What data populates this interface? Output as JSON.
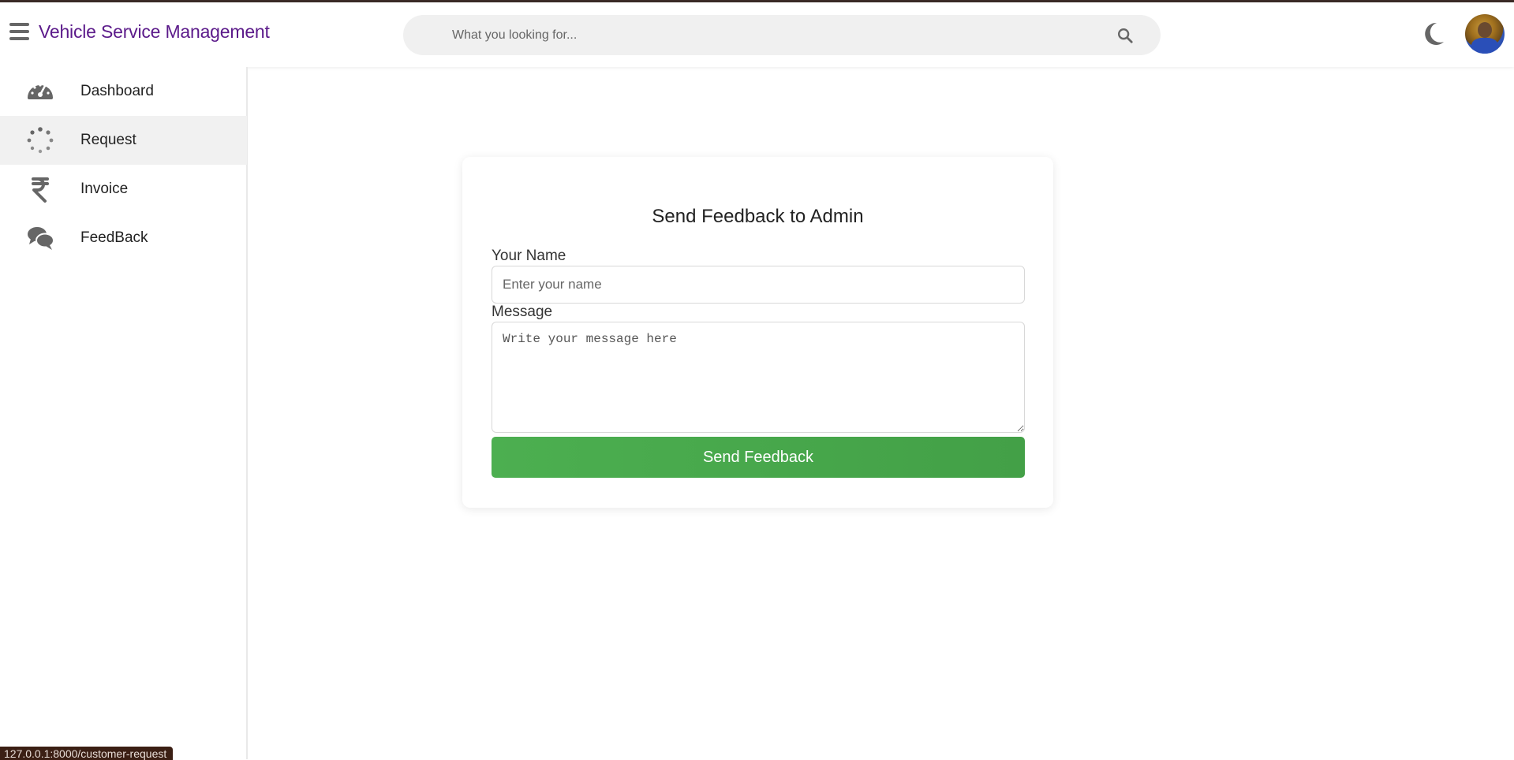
{
  "header": {
    "brand": "Vehicle Service Management",
    "search_placeholder": "What you looking for...",
    "icons": {
      "menu": "hamburger-menu-icon",
      "search": "search-icon",
      "theme": "moon-icon",
      "profile": "avatar"
    }
  },
  "sidebar": {
    "items": [
      {
        "label": "Dashboard",
        "icon": "speedometer-icon",
        "active": false
      },
      {
        "label": "Request",
        "icon": "spinner-icon",
        "active": true
      },
      {
        "label": "Invoice",
        "icon": "rupee-icon",
        "active": false
      },
      {
        "label": "FeedBack",
        "icon": "chat-icon",
        "active": false
      }
    ]
  },
  "feedback_form": {
    "title": "Send Feedback to Admin",
    "name_label": "Your Name",
    "name_placeholder": "Enter your name",
    "message_label": "Message",
    "message_placeholder": "Write your message here",
    "submit_label": "Send Feedback"
  },
  "status_bar": {
    "url": "127.0.0.1:8000/customer-request"
  },
  "colors": {
    "brand": "#5b1a8a",
    "submit": "#4caf50",
    "active_sidebar_bg": "#f1f1f1"
  }
}
